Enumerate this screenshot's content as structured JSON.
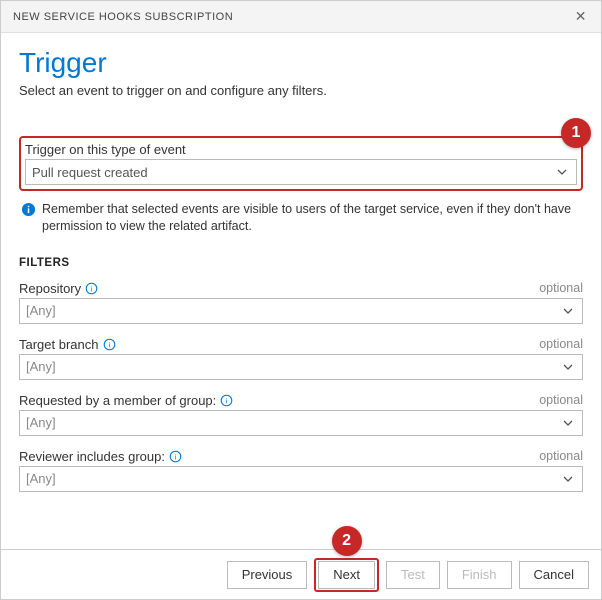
{
  "titlebar": {
    "title": "NEW SERVICE HOOKS SUBSCRIPTION"
  },
  "header": {
    "title": "Trigger",
    "subtitle": "Select an event to trigger on and configure any filters."
  },
  "eventField": {
    "label": "Trigger on this type of event",
    "value": "Pull request created",
    "badgeNumber": "1"
  },
  "info": {
    "text": "Remember that selected events are visible to users of the target service, even if they don't have permission to view the related artifact."
  },
  "filters": {
    "heading": "FILTERS",
    "items": [
      {
        "label": "Repository",
        "optional": "optional",
        "value": "[Any]"
      },
      {
        "label": "Target branch",
        "optional": "optional",
        "value": "[Any]"
      },
      {
        "label": "Requested by a member of group:",
        "optional": "optional",
        "value": "[Any]"
      },
      {
        "label": "Reviewer includes group:",
        "optional": "optional",
        "value": "[Any]"
      }
    ]
  },
  "footer": {
    "previous": "Previous",
    "next": "Next",
    "nextBadge": "2",
    "test": "Test",
    "finish": "Finish",
    "cancel": "Cancel"
  }
}
